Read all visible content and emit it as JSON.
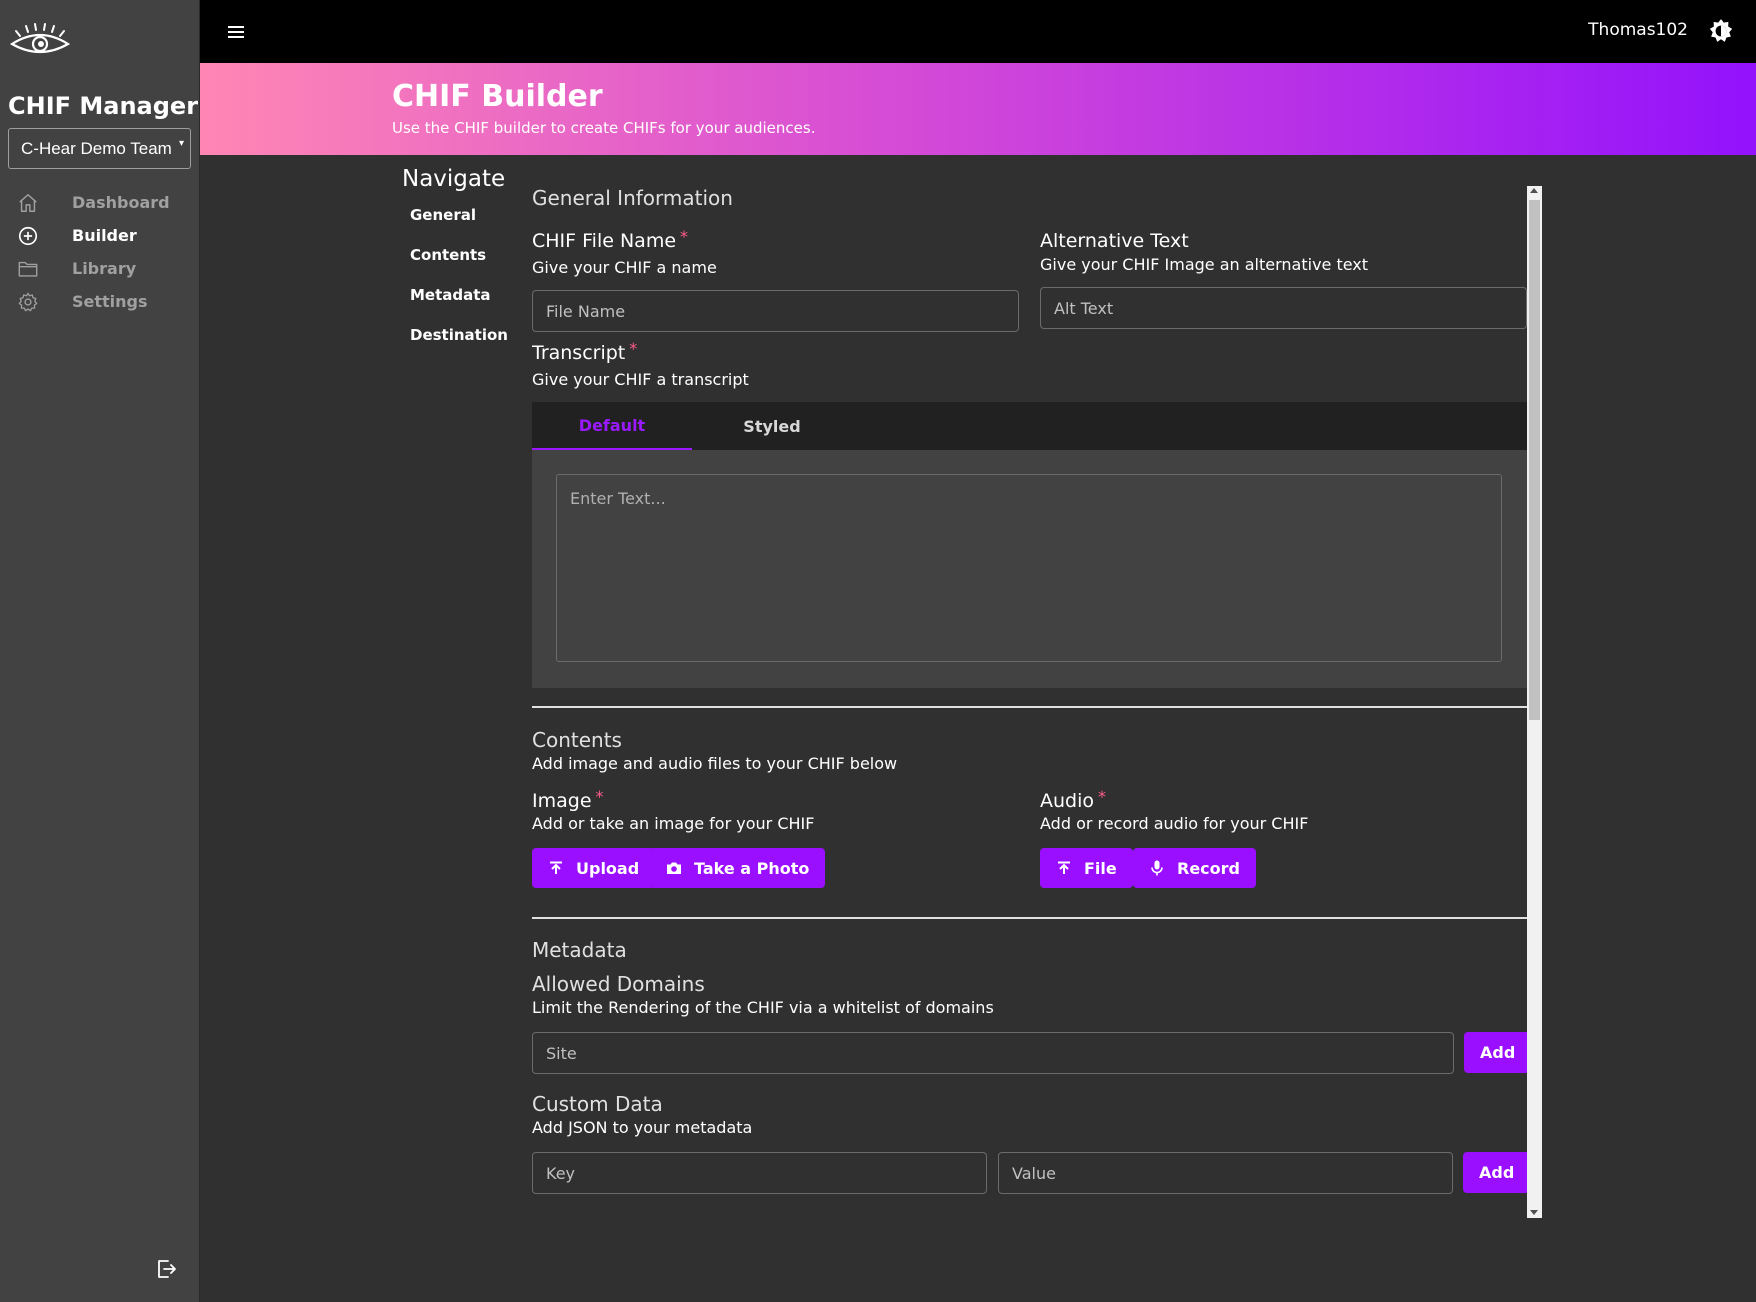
{
  "sidebar": {
    "app_title": "CHIF Manager",
    "team_select_value": "C-Hear Demo Team",
    "nav": [
      {
        "label": "Dashboard",
        "icon": "home-icon"
      },
      {
        "label": "Builder",
        "icon": "add-circle-icon"
      },
      {
        "label": "Library",
        "icon": "folder-icon"
      },
      {
        "label": "Settings",
        "icon": "gear-icon"
      }
    ],
    "active_item": "Builder"
  },
  "topbar": {
    "username": "Thomas102"
  },
  "hero": {
    "title": "CHIF Builder",
    "subtitle": "Use the CHIF builder to create CHIFs for your audiences."
  },
  "navigate": {
    "heading": "Navigate",
    "links": [
      "General",
      "Contents",
      "Metadata",
      "Destination"
    ]
  },
  "general": {
    "title": "General Information",
    "file_name": {
      "label": "CHIF File Name",
      "required": "*",
      "help": "Give your CHIF a name",
      "placeholder": "File Name"
    },
    "alt_text": {
      "label": "Alternative Text",
      "help": "Give your CHIF Image an alternative text",
      "placeholder": "Alt Text"
    },
    "transcript": {
      "label": "Transcript",
      "required": "*",
      "help": "Give your CHIF a transcript",
      "tabs": [
        "Default",
        "Styled"
      ],
      "active_tab": "Default",
      "placeholder": "Enter Text..."
    }
  },
  "contents": {
    "title": "Contents",
    "help": "Add image and audio files to your CHIF below",
    "image": {
      "label": "Image",
      "required": "*",
      "help": "Add or take an image for your CHIF",
      "upload_label": "Upload",
      "photo_label": "Take a Photo"
    },
    "audio": {
      "label": "Audio",
      "required": "*",
      "help": "Add or record audio for your CHIF",
      "file_label": "File",
      "record_label": "Record"
    }
  },
  "metadata": {
    "title": "Metadata",
    "allowed_domains": {
      "label": "Allowed Domains",
      "help": "Limit the Rendering of the CHIF via a whitelist of domains",
      "placeholder": "Site",
      "add_label": "Add"
    },
    "custom_data": {
      "label": "Custom Data",
      "help": "Add JSON to your metadata",
      "key_placeholder": "Key",
      "value_placeholder": "Value",
      "add_label": "Add"
    }
  },
  "colors": {
    "accent": "#9a0fff",
    "required": "#ff5c8a",
    "hero_gradient_start": "#ff86b4",
    "hero_gradient_end": "#9412fc",
    "background": "#303030",
    "sidebar": "#424242"
  }
}
